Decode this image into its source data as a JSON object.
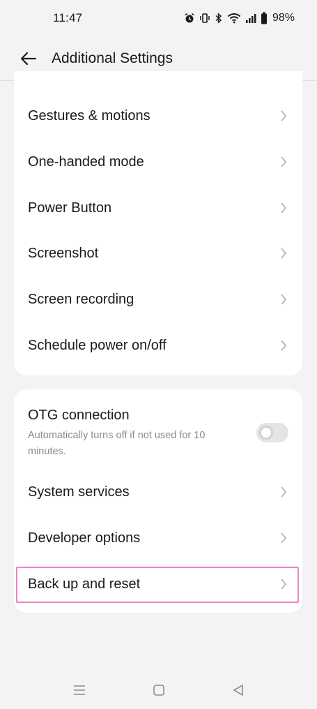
{
  "status_bar": {
    "time": "11:47",
    "battery": "98%",
    "icons": [
      "alarm-icon",
      "vibrate-icon",
      "bluetooth-icon",
      "wifi-icon",
      "signal-icon",
      "battery-icon"
    ]
  },
  "header": {
    "title": "Additional Settings",
    "back_icon": "arrow-left-icon"
  },
  "group1": {
    "items": [
      {
        "label": "Gestures & motions"
      },
      {
        "label": "One-handed mode"
      },
      {
        "label": "Power Button"
      },
      {
        "label": "Screenshot"
      },
      {
        "label": "Screen recording"
      },
      {
        "label": "Schedule power on/off"
      }
    ]
  },
  "group2": {
    "otg": {
      "title": "OTG connection",
      "subtitle": "Automatically turns off if not used for 10 minutes.",
      "enabled": false
    },
    "items": [
      {
        "label": "System services"
      },
      {
        "label": "Developer options"
      },
      {
        "label": "Back up and reset"
      }
    ]
  },
  "nav_bar": {
    "icons": [
      "menu-icon",
      "home-icon",
      "back-triangle-icon"
    ]
  },
  "colors": {
    "background": "#f3f3f3",
    "card": "#ffffff",
    "highlight": "#ee82c9",
    "chevron": "#b5b5b5"
  }
}
